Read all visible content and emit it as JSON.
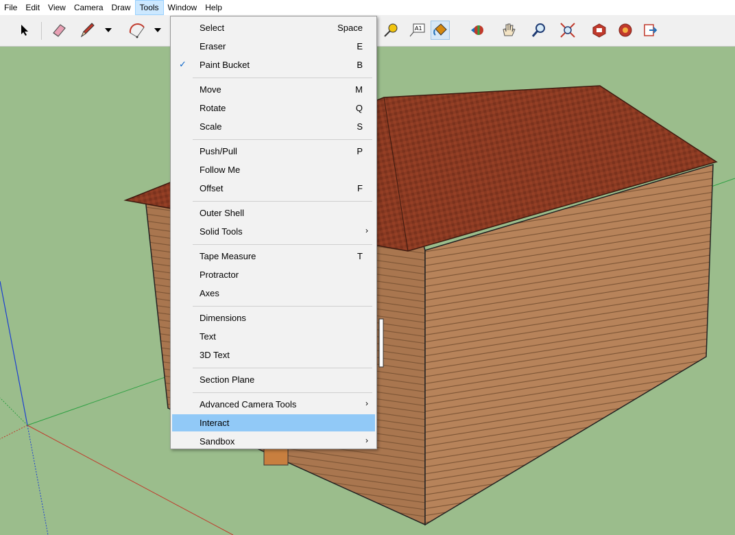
{
  "menubar": {
    "items": [
      {
        "label": "File"
      },
      {
        "label": "Edit"
      },
      {
        "label": "View"
      },
      {
        "label": "Camera"
      },
      {
        "label": "Draw"
      },
      {
        "label": "Tools"
      },
      {
        "label": "Window"
      },
      {
        "label": "Help"
      }
    ],
    "active": "Tools"
  },
  "toolbar": {
    "icons": [
      "select-arrow-icon",
      "eraser-icon",
      "pencil-line-icon",
      "dropdown-arrow-icon",
      "arc-icon",
      "dropdown-arrow-icon",
      "tape-measure-icon",
      "text-label-icon",
      "paint-bucket-icon",
      "orbit-icon",
      "pan-hand-icon",
      "zoom-icon",
      "zoom-extents-icon",
      "3d-warehouse-icon",
      "extension-warehouse-icon",
      "layout-send-icon"
    ]
  },
  "tools_menu": {
    "groups": [
      [
        {
          "label": "Select",
          "shortcut": "Space"
        },
        {
          "label": "Eraser",
          "shortcut": "E"
        },
        {
          "label": "Paint Bucket",
          "shortcut": "B",
          "checked": true
        }
      ],
      [
        {
          "label": "Move",
          "shortcut": "M"
        },
        {
          "label": "Rotate",
          "shortcut": "Q"
        },
        {
          "label": "Scale",
          "shortcut": "S"
        }
      ],
      [
        {
          "label": "Push/Pull",
          "shortcut": "P"
        },
        {
          "label": "Follow Me",
          "shortcut": ""
        },
        {
          "label": "Offset",
          "shortcut": "F"
        }
      ],
      [
        {
          "label": "Outer Shell",
          "shortcut": ""
        },
        {
          "label": "Solid Tools",
          "shortcut": "",
          "submenu": true
        }
      ],
      [
        {
          "label": "Tape Measure",
          "shortcut": "T"
        },
        {
          "label": "Protractor",
          "shortcut": ""
        },
        {
          "label": "Axes",
          "shortcut": ""
        }
      ],
      [
        {
          "label": "Dimensions",
          "shortcut": ""
        },
        {
          "label": "Text",
          "shortcut": ""
        },
        {
          "label": "3D Text",
          "shortcut": ""
        }
      ],
      [
        {
          "label": "Section Plane",
          "shortcut": ""
        }
      ],
      [
        {
          "label": "Advanced Camera Tools",
          "shortcut": "",
          "submenu": true
        },
        {
          "label": "Interact",
          "shortcut": "",
          "highlighted": true
        },
        {
          "label": "Sandbox",
          "shortcut": "",
          "submenu": true
        }
      ]
    ],
    "submenu_glyph": "›",
    "check_glyph": "✓"
  },
  "colors": {
    "ground": "#9bbd8c",
    "roof": "#8a3a22",
    "siding": "#b7835a",
    "menu_highlight": "#91c9f7",
    "axis_red": "#c0392b",
    "axis_green": "#2ea043",
    "axis_blue": "#1c3fd1"
  }
}
